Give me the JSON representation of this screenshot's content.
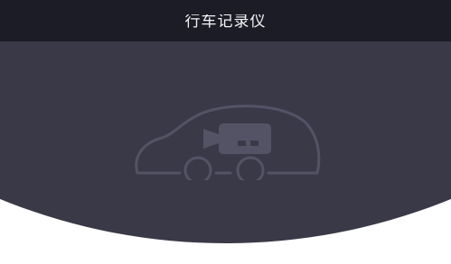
{
  "header": {
    "title": "行车记录仪"
  },
  "illustration": {
    "icon": "car-dashcam-icon"
  },
  "colors": {
    "header_bg": "#1b1c26",
    "hero_bg": "#3a3947",
    "icon_stroke": "#545366",
    "page_bg": "#ffffff"
  }
}
